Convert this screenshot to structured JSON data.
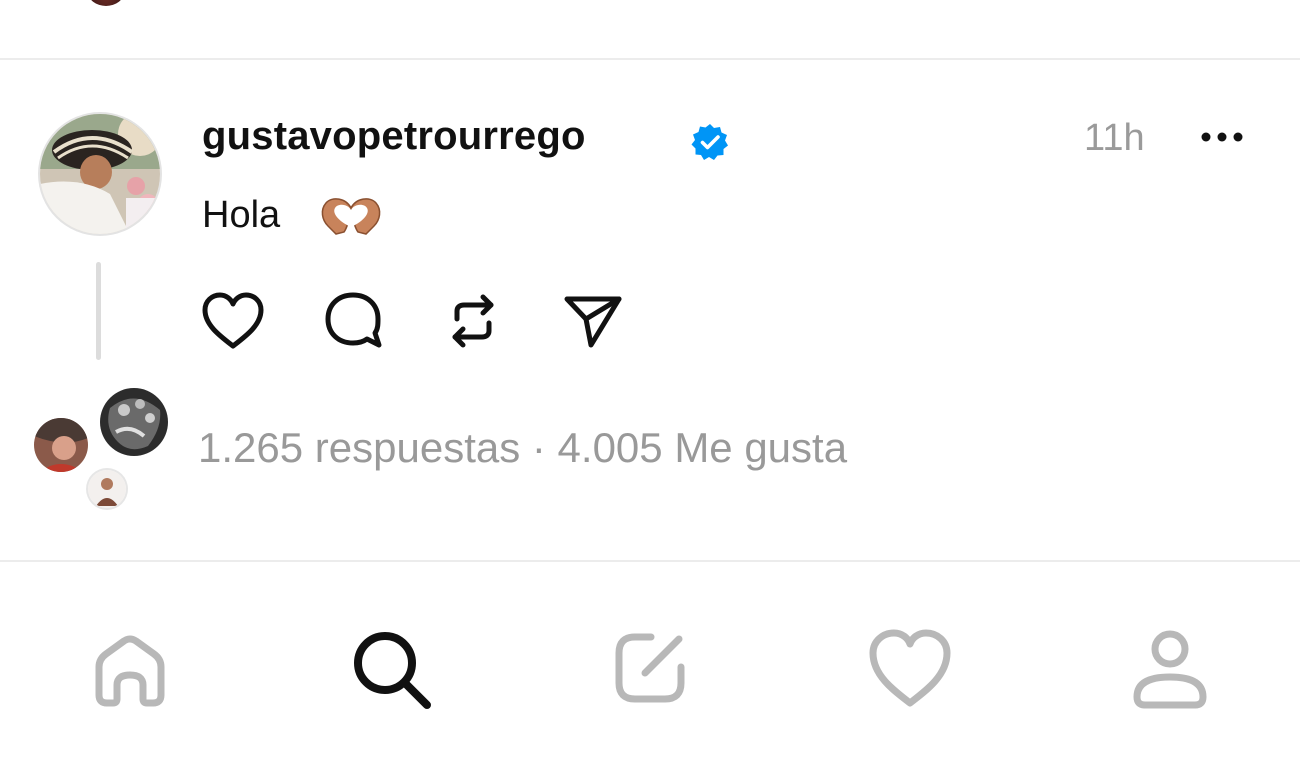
{
  "post": {
    "username": "gustavopetrourrego",
    "verified": true,
    "timestamp": "11h",
    "text": "Hola",
    "emoji": "heart-hands-emoji",
    "stats": "1.265 respuestas · 4.005 Me gusta"
  },
  "actions": [
    {
      "name": "like",
      "icon": "heart-icon"
    },
    {
      "name": "reply",
      "icon": "comment-icon"
    },
    {
      "name": "repost",
      "icon": "repost-icon"
    },
    {
      "name": "share",
      "icon": "send-icon"
    }
  ],
  "bottom_nav": [
    {
      "name": "home",
      "icon": "home-icon",
      "active": false
    },
    {
      "name": "search",
      "icon": "search-icon",
      "active": true
    },
    {
      "name": "compose",
      "icon": "compose-icon",
      "active": false
    },
    {
      "name": "activity",
      "icon": "heart-icon",
      "active": false
    },
    {
      "name": "profile",
      "icon": "user-icon",
      "active": false
    }
  ],
  "colors": {
    "verified": "#0095f6",
    "muted": "#999999",
    "inactive_nav": "#b8b8b8",
    "divider": "#ececec"
  }
}
